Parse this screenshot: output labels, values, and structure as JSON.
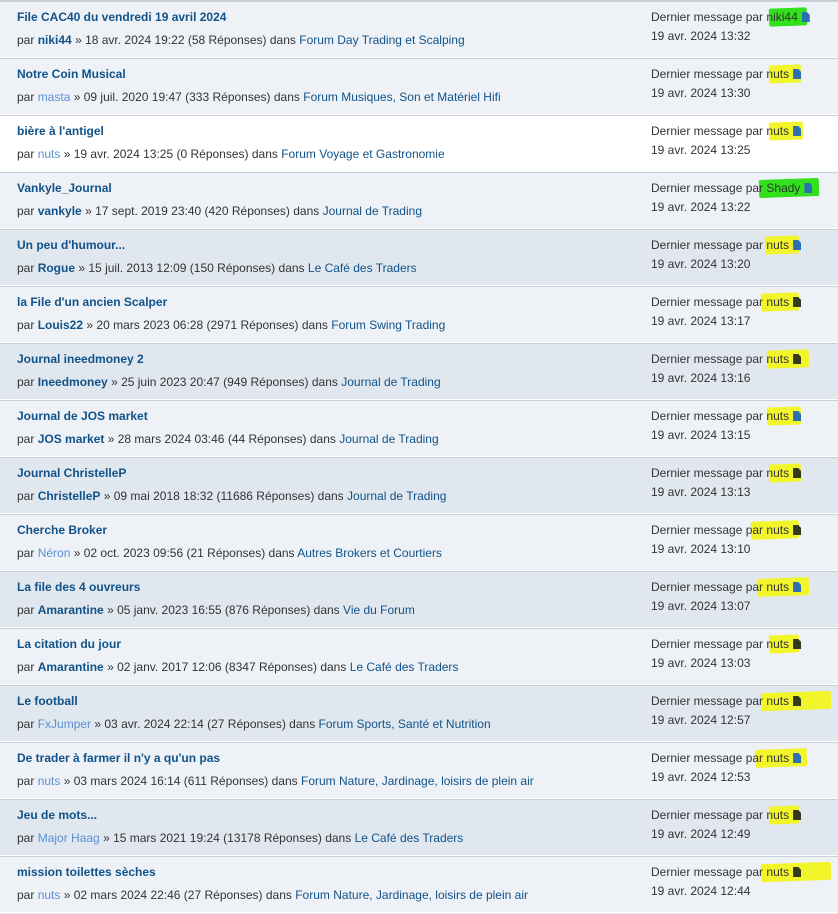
{
  "lastpost_label": "Dernier message par",
  "topics": [
    {
      "title": "File CAC40 du vendredi 19 avril 2024",
      "by": "par",
      "author": "niki44",
      "author_guest": false,
      "date": "» 18 avr. 2024 19:22 (58 Réponses) dans",
      "forum": "Forum Day Trading et Scalping",
      "last_user": "niki44",
      "last_date": "19 avr. 2024 13:32",
      "highlight": "green"
    },
    {
      "title": "Notre Coin Musical",
      "by": "par",
      "author": "masta",
      "author_guest": true,
      "date": "» 09 juil. 2020 19:47 (333 Réponses) dans",
      "forum": "Forum Musiques, Son et Matériel Hifi",
      "last_user": "nuts",
      "last_date": "19 avr. 2024 13:30",
      "highlight": "yellow"
    },
    {
      "title": "bière à l'antigel",
      "by": "par",
      "author": "nuts",
      "author_guest": true,
      "date": "» 19 avr. 2024 13:25 (0 Réponses) dans",
      "forum": "Forum Voyage et Gastronomie",
      "last_user": "nuts",
      "last_date": "19 avr. 2024 13:25",
      "highlight": "yellow"
    },
    {
      "title": "Vankyle_Journal",
      "by": "par",
      "author": "vankyle",
      "author_guest": false,
      "date": "» 17 sept. 2019 23:40 (420 Réponses) dans",
      "forum": "Journal de Trading",
      "last_user": "Shady",
      "last_date": "19 avr. 2024 13:22",
      "highlight": "green"
    },
    {
      "title": "Un peu d'humour...",
      "by": "par",
      "author": "Rogue",
      "author_guest": false,
      "date": "» 15 juil. 2013 12:09 (150 Réponses) dans",
      "forum": "Le Café des Traders",
      "last_user": "nuts",
      "last_date": "19 avr. 2024 13:20",
      "highlight": "yellow"
    },
    {
      "title": "la File d'un ancien Scalper",
      "by": "par",
      "author": "Louis22",
      "author_guest": false,
      "date": "» 20 mars 2023 06:28 (2971 Réponses) dans",
      "forum": "Forum Swing Trading",
      "last_user": "nuts",
      "last_date": "19 avr. 2024 13:17",
      "highlight": "yellow"
    },
    {
      "title": "Journal ineedmoney 2",
      "by": "par",
      "author": "Ineedmoney",
      "author_guest": false,
      "date": "» 25 juin 2023 20:47 (949 Réponses) dans",
      "forum": "Journal de Trading",
      "last_user": "nuts",
      "last_date": "19 avr. 2024 13:16",
      "highlight": "yellow"
    },
    {
      "title": "Journal de JOS market",
      "by": "par",
      "author": "JOS market",
      "author_guest": false,
      "date": "» 28 mars 2024 03:46 (44 Réponses) dans",
      "forum": "Journal de Trading",
      "last_user": "nuts",
      "last_date": "19 avr. 2024 13:15",
      "highlight": "yellow"
    },
    {
      "title": "Journal ChristelleP",
      "by": "par",
      "author": "ChristelleP",
      "author_guest": false,
      "date": "» 09 mai 2018 18:32 (11686 Réponses) dans",
      "forum": "Journal de Trading",
      "last_user": "nuts",
      "last_date": "19 avr. 2024 13:13",
      "highlight": "yellow"
    },
    {
      "title": "Cherche Broker",
      "by": "par",
      "author": "Néron",
      "author_guest": true,
      "date": "» 02 oct. 2023 09:56 (21 Réponses) dans",
      "forum": "Autres Brokers et Courtiers",
      "last_user": "nuts",
      "last_date": "19 avr. 2024 13:10",
      "highlight": "yellow"
    },
    {
      "title": "La file des 4 ouvreurs",
      "by": "par",
      "author": "Amarantine",
      "author_guest": false,
      "date": "» 05 janv. 2023 16:55 (876 Réponses) dans",
      "forum": "Vie du Forum",
      "last_user": "nuts",
      "last_date": "19 avr. 2024 13:07",
      "highlight": "yellow"
    },
    {
      "title": "La citation du jour",
      "by": "par",
      "author": "Amarantine",
      "author_guest": false,
      "date": "» 02 janv. 2017 12:06 (8347 Réponses) dans",
      "forum": "Le Café des Traders",
      "last_user": "nuts",
      "last_date": "19 avr. 2024 13:03",
      "highlight": "yellow"
    },
    {
      "title": "Le football",
      "by": "par",
      "author": "FxJumper",
      "author_guest": true,
      "date": "» 03 avr. 2024 22:14 (27 Réponses) dans",
      "forum": "Forum Sports, Santé et Nutrition",
      "last_user": "nuts",
      "last_date": "19 avr. 2024 12:57",
      "highlight": "yellow"
    },
    {
      "title": "De trader à farmer il n'y a qu'un pas",
      "by": "par",
      "author": "nuts",
      "author_guest": true,
      "date": "» 03 mars 2024 16:14 (611 Réponses) dans",
      "forum": "Forum Nature, Jardinage, loisirs de plein air",
      "last_user": "nuts",
      "last_date": "19 avr. 2024 12:53",
      "highlight": "yellow"
    },
    {
      "title": "Jeu de mots...",
      "by": "par",
      "author": "Major Haag",
      "author_guest": true,
      "date": "» 15 mars 2021 19:24 (13178 Réponses) dans",
      "forum": "Le Café des Traders",
      "last_user": "nuts",
      "last_date": "19 avr. 2024 12:49",
      "highlight": "yellow"
    },
    {
      "title": "mission toilettes sèches",
      "by": "par",
      "author": "nuts",
      "author_guest": true,
      "date": "» 02 mars 2024 22:46 (27 Réponses) dans",
      "forum": "Forum Nature, Jardinage, loisirs de plein air",
      "last_user": "nuts",
      "last_date": "19 avr. 2024 12:44",
      "highlight": "yellow"
    }
  ],
  "colors": {
    "link": "#105289",
    "guest_link": "#5b8fd4",
    "highlight_yellow": "#f2f52a",
    "highlight_green": "#33e01c"
  }
}
